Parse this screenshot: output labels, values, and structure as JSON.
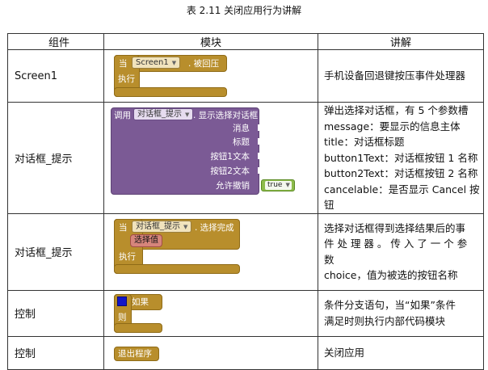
{
  "caption": "表 2.11    关闭应用行为讲解",
  "headers": [
    "组件",
    "模块",
    "讲解"
  ],
  "rows": [
    {
      "component": "Screen1",
      "desc": [
        "手机设备回退键按压事件处理器"
      ]
    },
    {
      "component": "对话框_提示",
      "desc": [
        "弹出选择对话框，有 5 个参数槽",
        "message：要显示的信息主体",
        "title：对话框标题",
        "button1Text：对话框按钮 1 名称",
        "button2Text：对话框按钮 2 名称",
        "cancelable：是否显示 Cancel 按钮"
      ]
    },
    {
      "component": "对话框_提示",
      "desc": [
        "选择对话框得到选择结果后的事",
        "件 处 理 器 。 传 入 了 一 个 参 数",
        "choice，值为被选的按钮名称"
      ]
    },
    {
      "component": "控制",
      "desc": [
        "条件分支语句，当“如果”条件",
        "满足时则执行内部代码模块"
      ]
    },
    {
      "component": "控制",
      "desc": [
        "关闭应用"
      ]
    }
  ],
  "blocks": {
    "b1": {
      "when": "当",
      "component": "Screen1",
      "event": ". 被回压",
      "do": "执行"
    },
    "b2": {
      "call": "调用",
      "component": "对话框_提示",
      "method": ". 显示选择对话框",
      "params": [
        "消息",
        "标题",
        "按钮1文本",
        "按钮2文本",
        "允许撤销"
      ],
      "value": "true"
    },
    "b3": {
      "when": "当",
      "component": "对话框_提示",
      "event": ". 选择完成",
      "param": "选择值",
      "do": "执行"
    },
    "b4": {
      "if": "如果",
      "then": "则"
    },
    "b5": {
      "label": "退出程序"
    }
  },
  "colors": {
    "event_block": "#b88e2c",
    "method_block": "#7b5a95",
    "logic_block": "#8dbb4b"
  }
}
